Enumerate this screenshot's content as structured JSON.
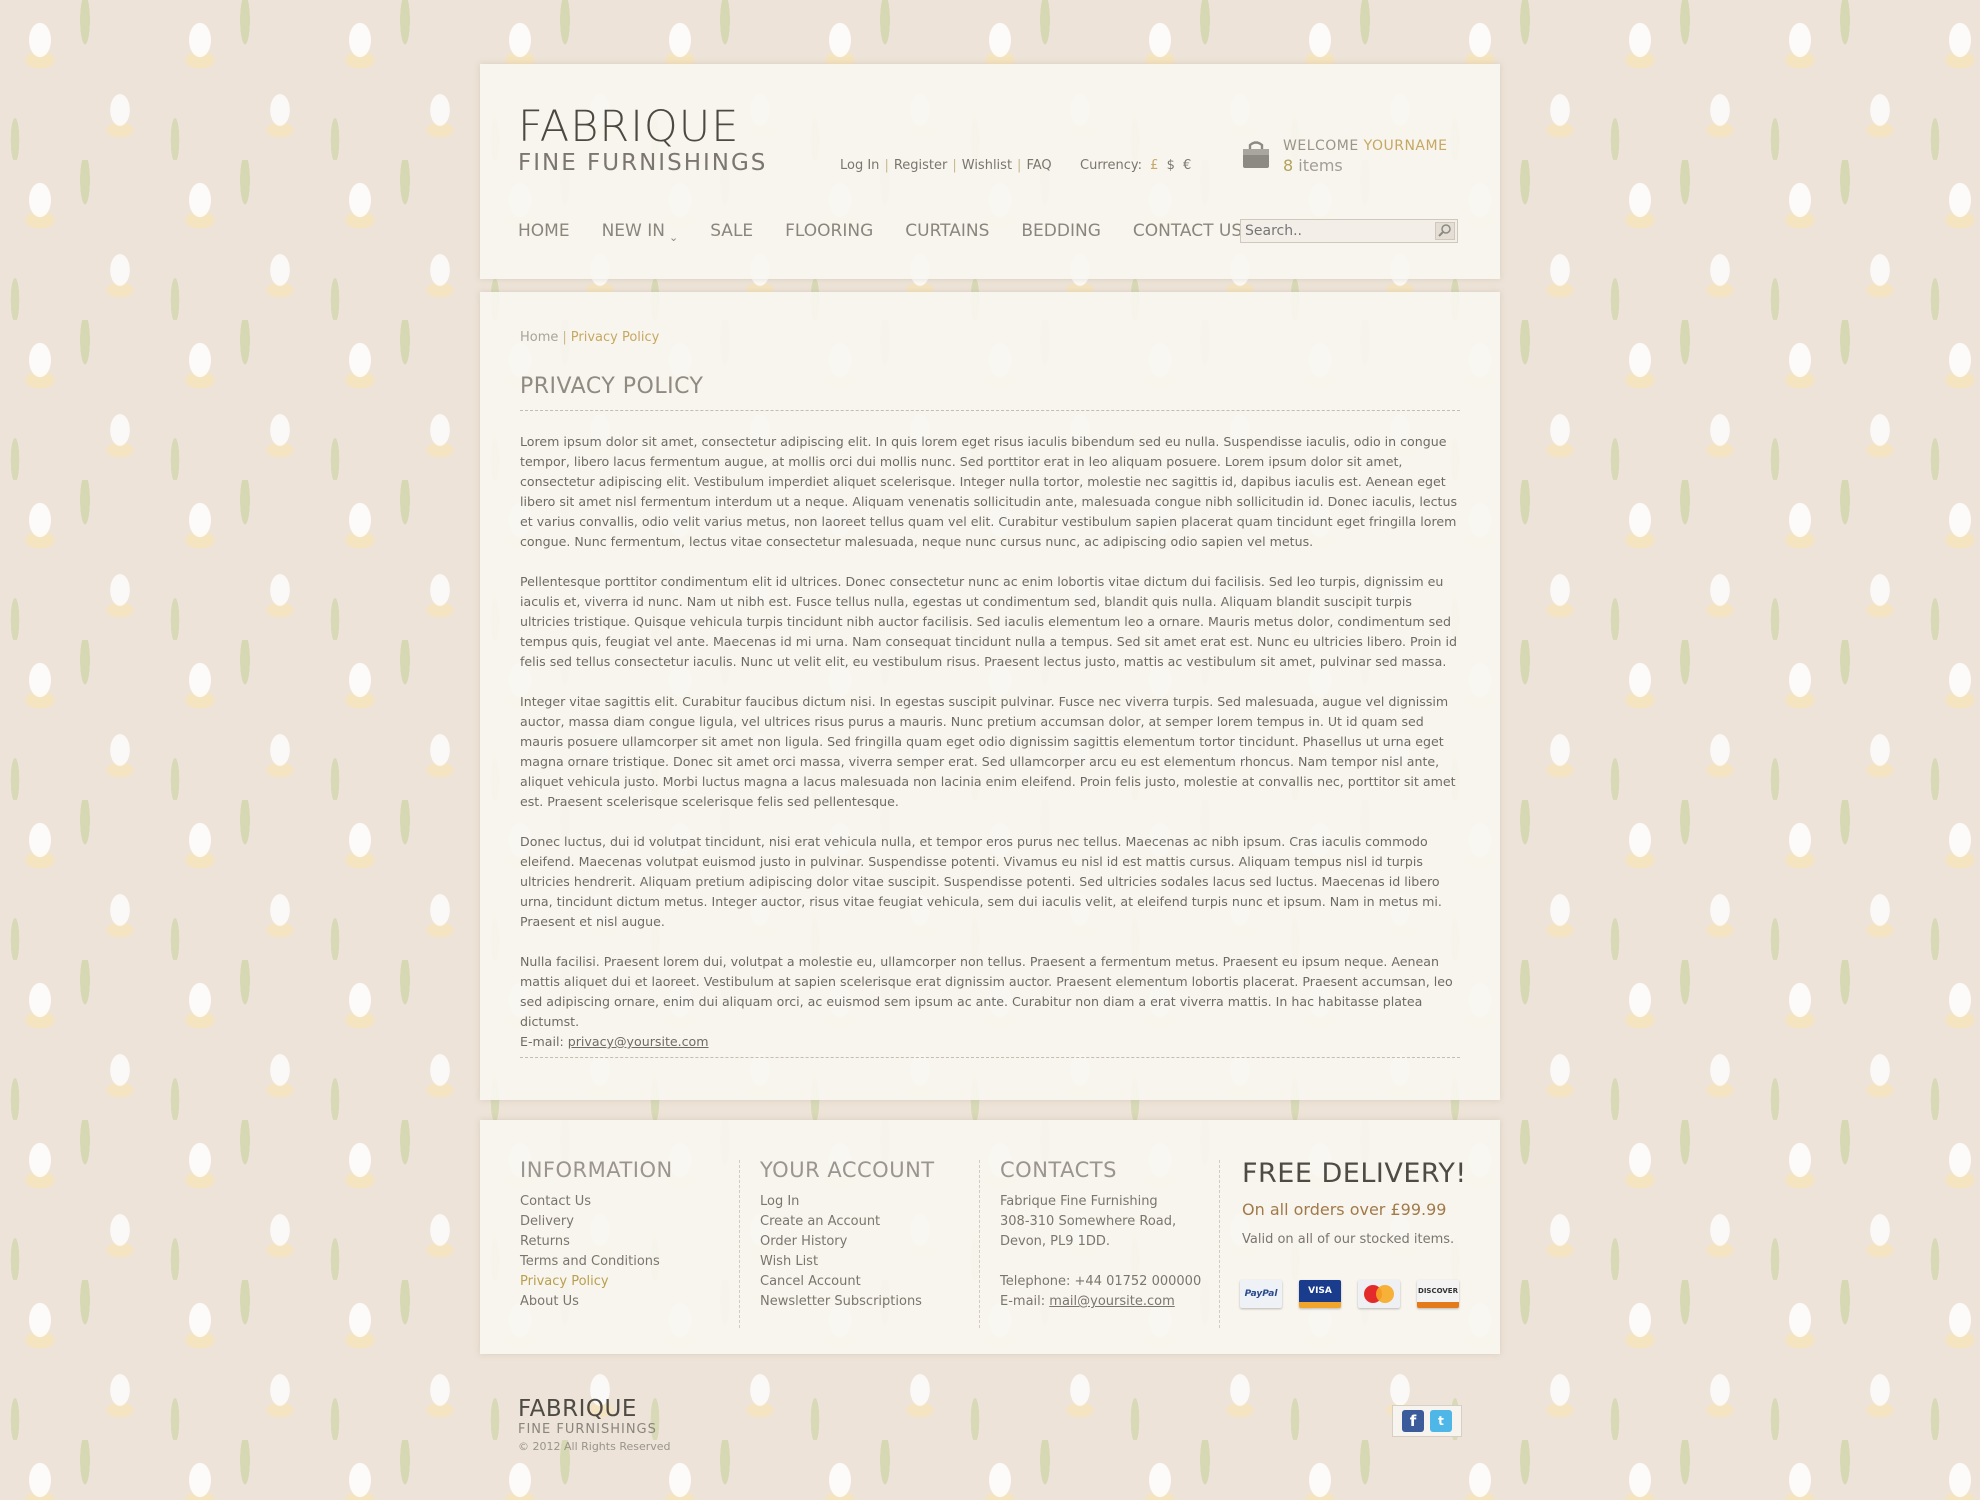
{
  "header": {
    "logo_title": "FABRIQUE",
    "logo_subtitle": "FINE FURNISHINGS",
    "top_links": [
      "Log In",
      "Register",
      "Wishlist",
      "FAQ"
    ],
    "currency_label": "Currency:",
    "currencies": [
      "£",
      "$",
      "€"
    ],
    "cart_welcome": "WELCOME",
    "cart_username": "YOURNAME",
    "cart_count": "8",
    "cart_items_label": "items",
    "nav": [
      "HOME",
      "NEW IN",
      "SALE",
      "FLOORING",
      "CURTAINS",
      "BEDDING",
      "CONTACT US"
    ],
    "search_placeholder": "Search.."
  },
  "content": {
    "breadcrumb": [
      "Home",
      "Privacy Policy"
    ],
    "title": "PRIVACY POLICY",
    "paragraphs": [
      "Lorem ipsum dolor sit amet, consectetur adipiscing elit. In quis lorem eget risus iaculis bibendum sed eu nulla. Suspendisse iaculis, odio in congue tempor, libero lacus fermentum augue, at mollis orci dui mollis nunc. Sed porttitor erat in leo aliquam posuere. Lorem ipsum dolor sit amet, consectetur adipiscing elit. Vestibulum imperdiet aliquet scelerisque. Integer nulla tortor, molestie nec sagittis id, dapibus iaculis est. Aenean eget libero sit amet nisl fermentum interdum ut a neque. Aliquam venenatis sollicitudin ante, malesuada congue nibh sollicitudin id. Donec iaculis, lectus et varius convallis, odio velit varius metus, non laoreet tellus quam vel elit. Curabitur vestibulum sapien placerat quam tincidunt eget fringilla lorem congue. Nunc fermentum, lectus vitae consectetur malesuada, neque nunc cursus nunc, ac adipiscing odio sapien vel metus.",
      "Pellentesque porttitor condimentum elit id ultrices. Donec consectetur nunc ac enim lobortis vitae dictum dui facilisis. Sed leo turpis, dignissim eu iaculis et, viverra id nunc. Nam ut nibh est. Fusce tellus nulla, egestas ut condimentum sed, blandit quis nulla. Aliquam blandit suscipit turpis ultricies tristique. Quisque vehicula turpis tincidunt nibh auctor facilisis. Sed iaculis elementum leo a ornare. Mauris metus dolor, condimentum sed tempus quis, feugiat vel ante. Maecenas id mi urna. Nam consequat tincidunt nulla a tempus. Sed sit amet erat est. Nunc eu ultricies libero. Proin id felis sed tellus consectetur iaculis. Nunc ut velit elit, eu vestibulum risus. Praesent lectus justo, mattis ac vestibulum sit amet, pulvinar sed massa.",
      "Integer vitae sagittis elit. Curabitur faucibus dictum nisi. In egestas suscipit pulvinar. Fusce nec viverra turpis. Sed malesuada, augue vel dignissim auctor, massa diam congue ligula, vel ultrices risus purus a mauris. Nunc pretium accumsan dolor, at semper lorem tempus in. Ut id quam sed mauris posuere ullamcorper sit amet non ligula. Sed fringilla quam eget odio dignissim sagittis elementum tortor tincidunt. Phasellus ut urna eget magna ornare tristique. Donec sit amet orci massa, viverra semper erat. Sed ullamcorper arcu eu est elementum rhoncus. Nam tempor nisl ante, aliquet vehicula justo. Morbi luctus magna a lacus malesuada non lacinia enim eleifend. Proin felis justo, molestie at convallis nec, porttitor sit amet est. Praesent scelerisque scelerisque felis sed pellentesque.",
      "Donec luctus, dui id volutpat tincidunt, nisi erat vehicula nulla, et tempor eros purus nec tellus. Maecenas ac nibh ipsum. Cras iaculis commodo eleifend. Maecenas volutpat euismod justo in pulvinar. Suspendisse potenti. Vivamus eu nisl id est mattis cursus. Aliquam tempus nisl id turpis ultricies hendrerit. Aliquam pretium adipiscing dolor vitae suscipit. Suspendisse potenti. Sed ultricies sodales lacus sed luctus. Maecenas id libero urna, tincidunt dictum metus. Integer auctor, risus vitae feugiat vehicula, sem dui iaculis velit, at eleifend turpis nunc et ipsum. Nam in metus mi. Praesent et nisl augue.",
      "Nulla facilisi. Praesent lorem dui, volutpat a molestie eu, ullamcorper non tellus. Praesent a fermentum metus. Praesent eu ipsum neque. Aenean mattis aliquet dui et laoreet. Vestibulum at sapien scelerisque erat dignissim auctor. Praesent elementum lobortis placerat. Praesent accumsan, leo sed adipiscing ornare, enim dui aliquam orci, ac euismod sem ipsum ac ante. Curabitur non diam a erat viverra mattis. In hac habitasse platea dictumst."
    ],
    "email_label": "E-mail:",
    "email": "privacy@yoursite.com"
  },
  "footer": {
    "information": {
      "title": "INFORMATION",
      "links": [
        "Contact Us",
        "Delivery",
        "Returns",
        "Terms and Conditions",
        "Privacy Policy",
        "About Us"
      ]
    },
    "account": {
      "title": "YOUR ACCOUNT",
      "links": [
        "Log In",
        "Create an Account",
        "Order History",
        "Wish List",
        "Cancel Account",
        "Newsletter Subscriptions"
      ]
    },
    "contacts": {
      "title": "CONTACTS",
      "company": "Fabrique Fine Furnishing",
      "address1": "308-310 Somewhere Road,",
      "address2": "Devon,  PL9 1DD.",
      "telephone": "Telephone: +44 01752 000000",
      "email_label": "E-mail:",
      "email": "mail@yoursite.com"
    },
    "delivery": {
      "title": "FREE DELIVERY!",
      "subtitle": "On all orders over £99.99",
      "note": "Valid on all of our stocked items."
    },
    "cards": [
      "PayPal",
      "VISA",
      "MasterCard",
      "DISCOVER"
    ]
  },
  "bottom": {
    "logo_title": "FABRIQUE",
    "logo_subtitle": "FINE FURNISHINGS",
    "copyright": "© 2012 All Rights Reserved"
  },
  "colors": {
    "accent_gold": "#c6a862",
    "background": "#ede3d8",
    "panel": "#f8f6f1"
  },
  "icons": [
    "cart-icon",
    "search-icon",
    "facebook-icon",
    "twitter-icon",
    "chevron-down-icon"
  ]
}
